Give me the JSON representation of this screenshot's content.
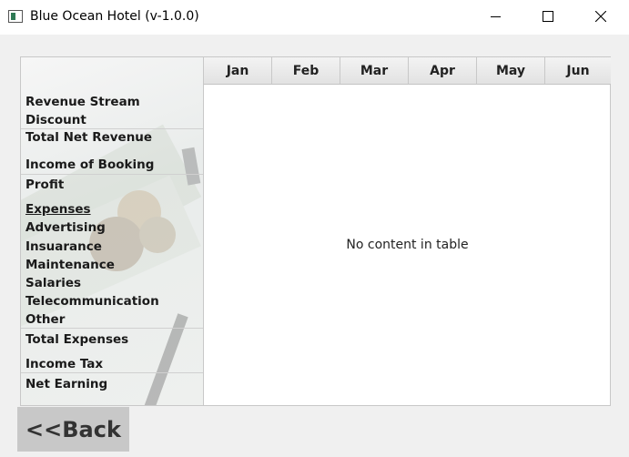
{
  "window": {
    "title": "Blue Ocean Hotel (v-1.0.0)"
  },
  "sidebar": {
    "rows": [
      {
        "id": "revenue-stream",
        "label": "Revenue Stream"
      },
      {
        "id": "discount",
        "label": "Discount"
      },
      {
        "id": "total-net-revenue",
        "label": "Total Net Revenue"
      },
      {
        "id": "income-of-booking",
        "label": "Income of Booking"
      },
      {
        "id": "profit",
        "label": "Profit"
      },
      {
        "id": "expenses",
        "label": "Expenses"
      },
      {
        "id": "advertising",
        "label": "Advertising"
      },
      {
        "id": "insurance",
        "label": "Insuarance"
      },
      {
        "id": "maintenance",
        "label": "Maintenance"
      },
      {
        "id": "salaries",
        "label": "Salaries"
      },
      {
        "id": "telecommunication",
        "label": "Telecommunication"
      },
      {
        "id": "other",
        "label": "Other"
      },
      {
        "id": "total-expenses",
        "label": "Total Expenses"
      },
      {
        "id": "income-tax",
        "label": "Income Tax"
      },
      {
        "id": "net-earning",
        "label": "Net Earning"
      }
    ]
  },
  "table": {
    "columns": [
      "Jan",
      "Feb",
      "Mar",
      "Apr",
      "May",
      "Jun"
    ],
    "placeholder": "No content in table"
  },
  "buttons": {
    "back_label": "<<Back"
  }
}
